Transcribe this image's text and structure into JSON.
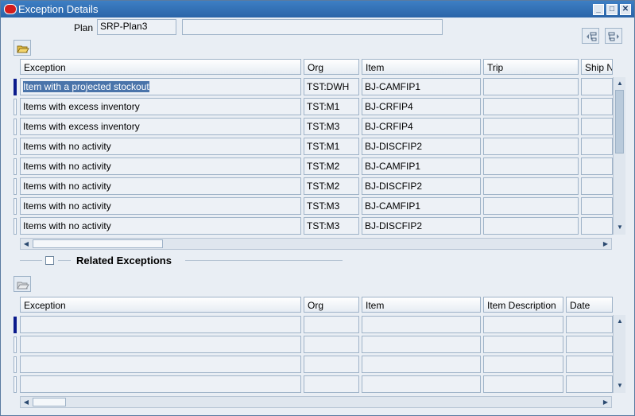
{
  "window": {
    "title": "Exception Details",
    "controls": [
      "_",
      "□",
      "✕"
    ]
  },
  "plan": {
    "label": "Plan",
    "value": "SRP-Plan3",
    "description": ""
  },
  "top_grid": {
    "headers": [
      "Exception",
      "Org",
      "Item",
      "Trip",
      "Ship N"
    ],
    "rows": [
      [
        "Item with a projected stockout",
        "TST:DWH",
        "BJ-CAMFIP1",
        "",
        ""
      ],
      [
        "Items with excess inventory",
        "TST:M1",
        "BJ-CRFIP4",
        "",
        ""
      ],
      [
        "Items with excess inventory",
        "TST:M3",
        "BJ-CRFIP4",
        "",
        ""
      ],
      [
        "Items with no activity",
        "TST:M1",
        "BJ-DISCFIP2",
        "",
        ""
      ],
      [
        "Items with no activity",
        "TST:M2",
        "BJ-CAMFIP1",
        "",
        ""
      ],
      [
        "Items with no activity",
        "TST:M2",
        "BJ-DISCFIP2",
        "",
        ""
      ],
      [
        "Items with no activity",
        "TST:M3",
        "BJ-CAMFIP1",
        "",
        ""
      ],
      [
        "Items with no activity",
        "TST:M3",
        "BJ-DISCFIP2",
        "",
        ""
      ]
    ],
    "selected_row": 0
  },
  "related": {
    "label": "Related Exceptions",
    "checked": false
  },
  "bottom_grid": {
    "headers": [
      "Exception",
      "Org",
      "Item",
      "Item Description",
      "Date"
    ],
    "rows": [
      [
        "",
        "",
        "",
        "",
        ""
      ],
      [
        "",
        "",
        "",
        "",
        ""
      ],
      [
        "",
        "",
        "",
        "",
        ""
      ],
      [
        "",
        "",
        "",
        "",
        ""
      ]
    ]
  },
  "icons": {
    "open_folder": "folder-open-icon",
    "expand": "tree-expand-icon",
    "collapse": "tree-collapse-icon"
  }
}
